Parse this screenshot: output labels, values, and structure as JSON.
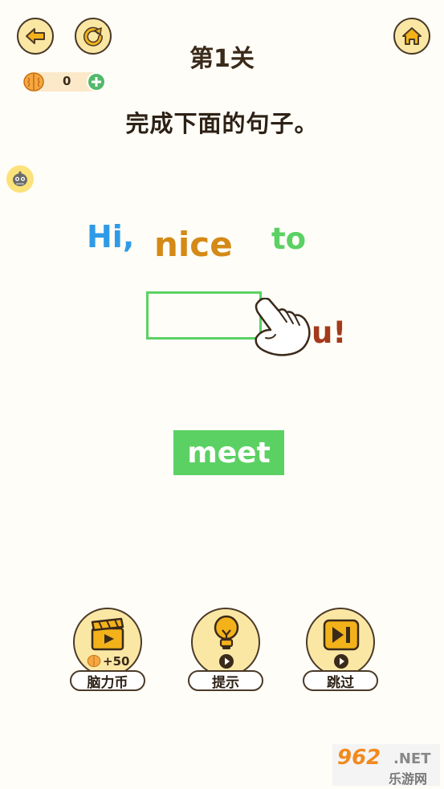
{
  "header": {
    "level_title": "第1关",
    "coins": "0"
  },
  "instruction": "完成下面的句子。",
  "sentence": {
    "hi": "Hi,",
    "nice": "nice",
    "to": "to",
    "tail": "u!"
  },
  "option_word": "meet",
  "tools": {
    "coins_reward": "+50",
    "coins_label": "脑力币",
    "hint_label": "提示",
    "skip_label": "跳过"
  },
  "watermark": {
    "top": "962",
    "dot": ".NET",
    "bottom": "乐游网"
  },
  "colors": {
    "hi": "#2f9be8",
    "nice": "#d48a16",
    "to": "#5bd163",
    "tail": "#a33a1a",
    "accent_green": "#5cd163",
    "button_fill": "#fbe7a4",
    "outline": "#4a3a28"
  }
}
